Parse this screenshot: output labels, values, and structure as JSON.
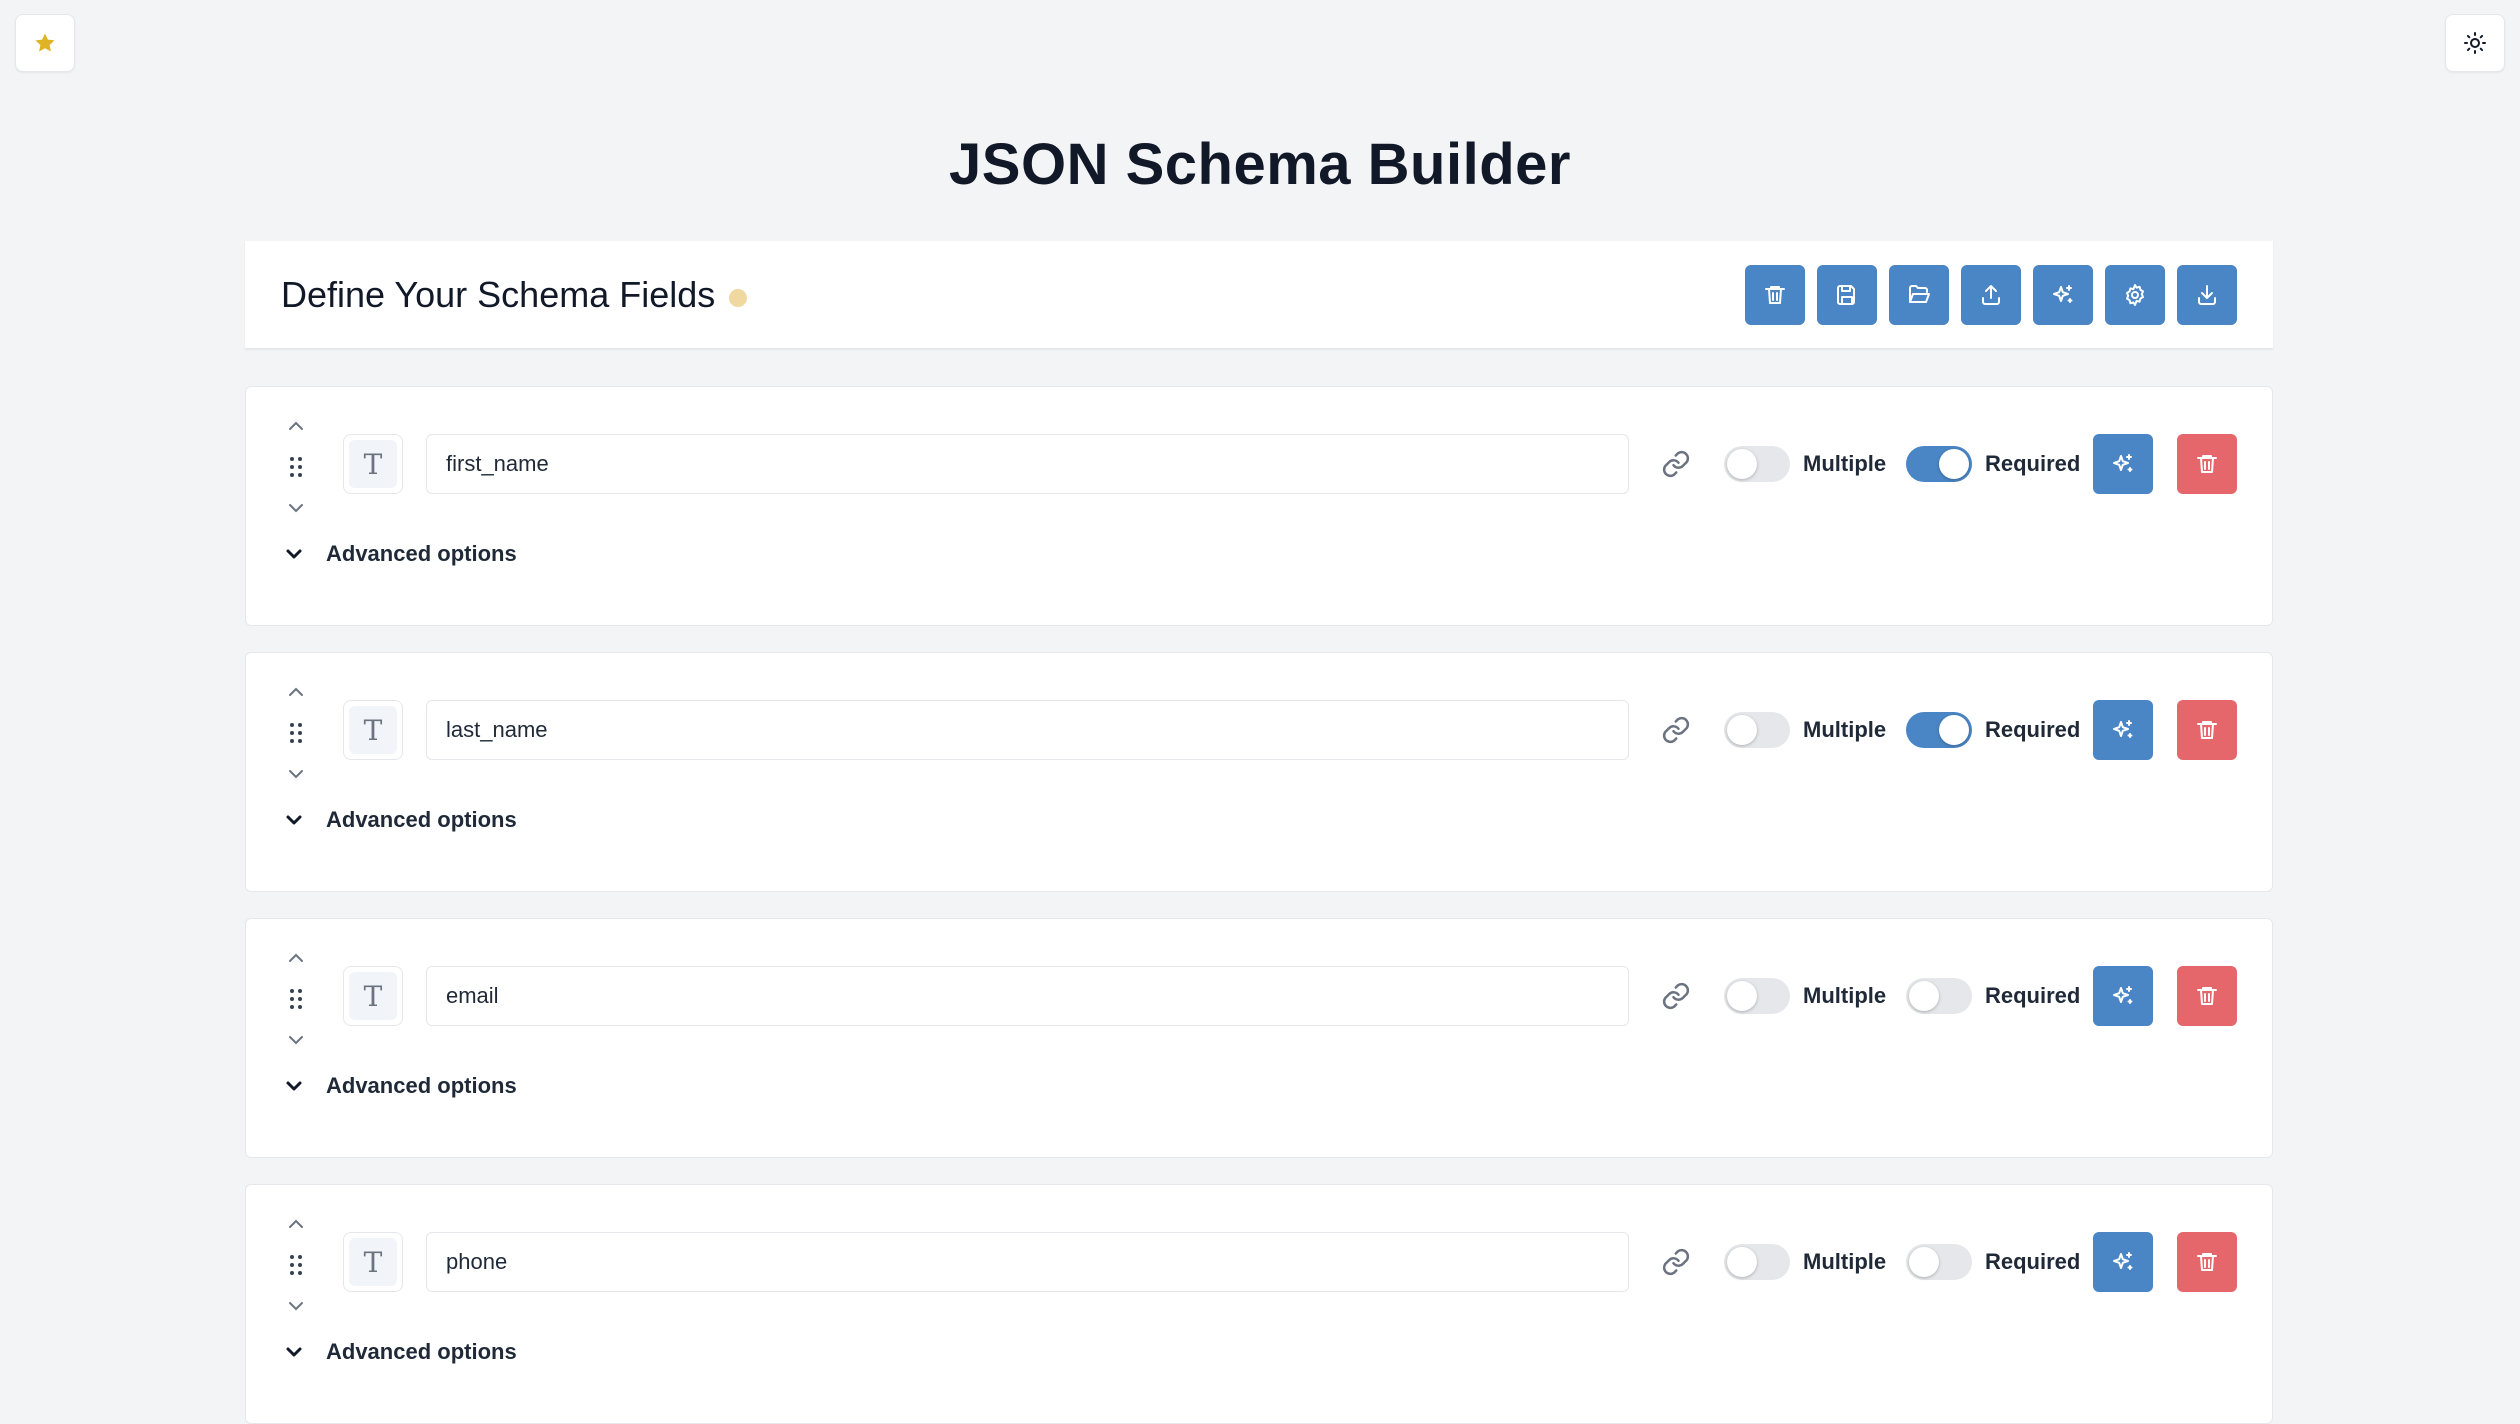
{
  "app": {
    "title": "JSON Schema Builder",
    "accent_color": "#4a86c5",
    "danger_color": "#e5676b",
    "star_color": "#e0b324",
    "status_dot_color": "#f0d9a0"
  },
  "corner_buttons": {
    "left_icon": "star-icon",
    "right_icon": "sun-icon"
  },
  "header": {
    "title": "Define Your Schema Fields",
    "toolbar": [
      {
        "icon": "trash-icon"
      },
      {
        "icon": "save-icon"
      },
      {
        "icon": "folder-open-icon"
      },
      {
        "icon": "upload-icon"
      },
      {
        "icon": "sparkles-icon"
      },
      {
        "icon": "gear-icon"
      },
      {
        "icon": "download-icon"
      }
    ]
  },
  "labels": {
    "multiple": "Multiple",
    "required": "Required",
    "advanced_options": "Advanced options",
    "type_glyph": "T"
  },
  "fields": [
    {
      "name": "first_name",
      "multiple": false,
      "required": true
    },
    {
      "name": "last_name",
      "multiple": false,
      "required": true
    },
    {
      "name": "email",
      "multiple": false,
      "required": false
    },
    {
      "name": "phone",
      "multiple": false,
      "required": false
    }
  ]
}
